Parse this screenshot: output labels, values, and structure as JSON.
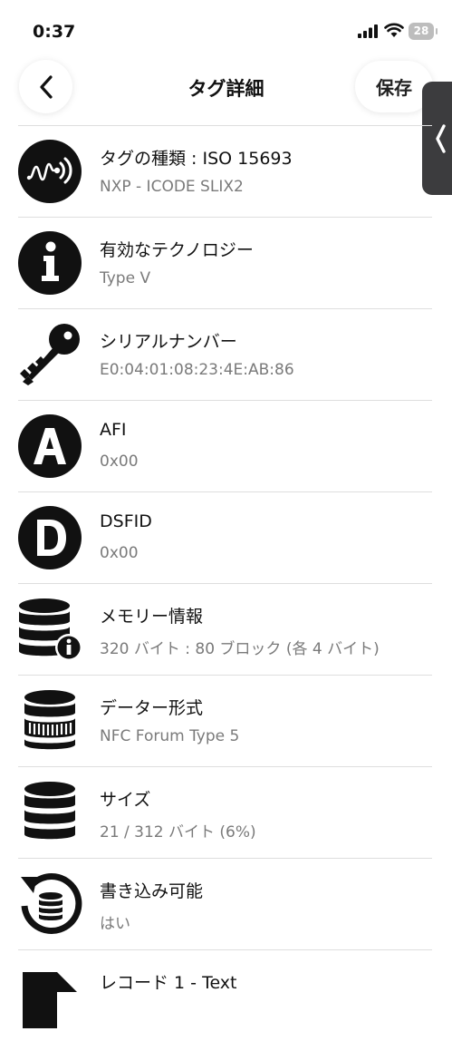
{
  "status_bar": {
    "time": "0:37",
    "battery": "28"
  },
  "nav": {
    "title": "タグ詳細",
    "save_label": "保存"
  },
  "rows": [
    {
      "title": "タグの種類 : ISO 15693",
      "value": "NXP - ICODE SLIX2",
      "icon": "nfc-tag-icon"
    },
    {
      "title": "有効なテクノロジー",
      "value": "Type V",
      "icon": "info-icon"
    },
    {
      "title": "シリアルナンバー",
      "value": "E0:04:01:08:23:4E:AB:86",
      "icon": "key-icon"
    },
    {
      "title": "AFI",
      "value": "0x00",
      "icon": "letter-a-icon"
    },
    {
      "title": "DSFID",
      "value": "0x00",
      "icon": "letter-d-icon"
    },
    {
      "title": "メモリー情報",
      "value": "320 バイト : 80 ブロック (各 4 バイト)",
      "icon": "database-info-icon"
    },
    {
      "title": "データー形式",
      "value": "NFC Forum Type 5",
      "icon": "database-format-icon"
    },
    {
      "title": "サイズ",
      "value": "21 / 312 バイト (6%)",
      "icon": "database-icon"
    },
    {
      "title": "書き込み可能",
      "value": "はい",
      "icon": "database-refresh-icon"
    },
    {
      "title": "レコード 1 - Text",
      "value": "",
      "icon": "record-icon"
    }
  ],
  "colors": {
    "icon": "#111111",
    "divider": "#dedede",
    "secondary_text": "#7a7a7a",
    "side_tab": "#3c3c3e"
  }
}
